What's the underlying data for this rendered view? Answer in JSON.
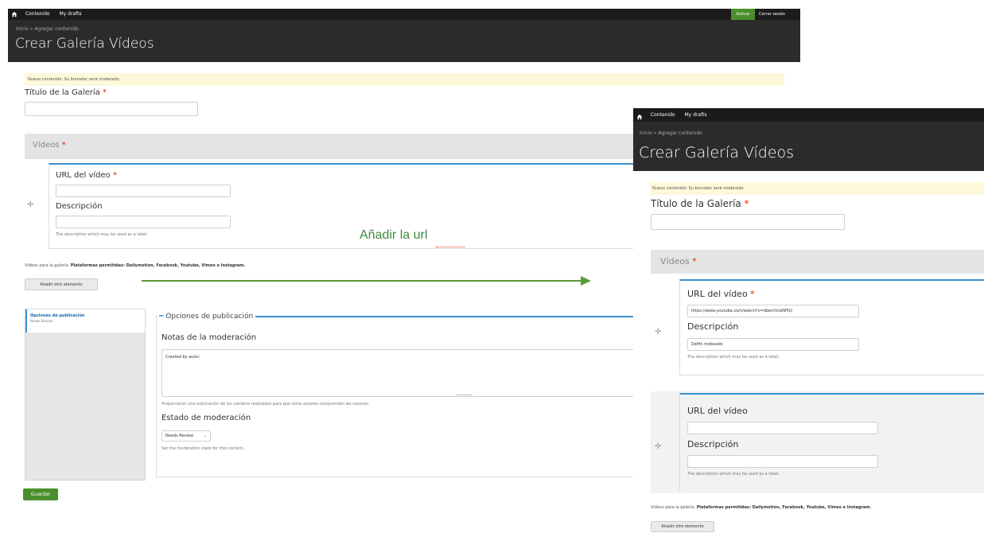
{
  "toolbar": {
    "contenido": "Contenido",
    "drafts": "My drafts",
    "active_btn": "Activar",
    "logout": "Cerrar sesión"
  },
  "breadcrumb": "Inicio » Agregar contenido",
  "page_title": "Crear Galería Vídeos",
  "message": "Nuevo contenido: Su borrador será moderado.",
  "gallery_title_label": "Título de la Galería",
  "required_mark": "*",
  "videos_label": "Vídeos",
  "video_url_label": "URL del vídeo",
  "description_label": "Descripción",
  "description_help": "The description which may be used as a label.",
  "gallery_help_prefix": "Vídeos para la galería.",
  "gallery_help_bold": "Plataformas permitidas: Dailymotion, Facebook, Youtube, Vimeo e Instagram.",
  "add_element_button": "Añadir otro elemento",
  "publish_tab": {
    "title": "Opciones de publicación",
    "subtitle": "Needs Review"
  },
  "publish_fieldset_legend": "Opciones de publicación",
  "moderation_notes_label": "Notas de la moderación",
  "moderation_notes_value": "Created by autor.",
  "moderation_notes_help": "Proporcionar una explicación de los cambios realizados para que otros autores comprendan las razones.",
  "moderation_state_label": "Estado de moderación",
  "moderation_state_value": "Needs Review",
  "moderation_state_help": "Set the moderation state for this content.",
  "save_button": "Guardar",
  "annotation": "Añadir la url",
  "right": {
    "video1_url_value": "https://www.youtube.com/watch?v=dbemVcbNf5Q",
    "video1_desc_value": "Delfin mobeado"
  },
  "colors": {
    "toolbar": "#1b1b1b",
    "header": "#2b2b2b",
    "accent_blue": "#3b91d0",
    "save_green": "#4a8f2c",
    "arrow_green": "#5a9b3a",
    "required_red": "#e32700",
    "message_bg": "#fdf8d9"
  }
}
